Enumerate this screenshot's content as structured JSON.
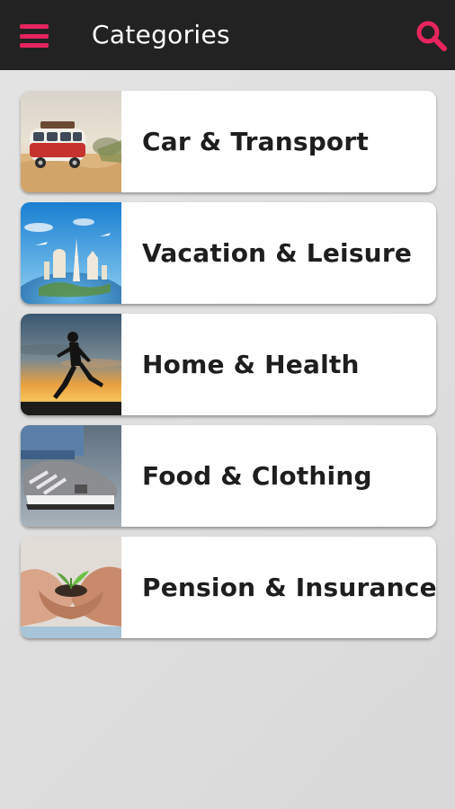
{
  "appbar": {
    "title": "Categories",
    "menu_icon": "hamburger-menu-icon",
    "search_icon": "search-icon",
    "accent_color": "#e8245f",
    "background_color": "#222222"
  },
  "categories": [
    {
      "label": "Car & Transport",
      "image": "vintage-van-on-beach"
    },
    {
      "label": "Vacation & Leisure",
      "image": "globe-with-world-landmarks"
    },
    {
      "label": "Home & Health",
      "image": "runner-silhouette-at-sunset"
    },
    {
      "label": "Food & Clothing",
      "image": "sneakers-close-up"
    },
    {
      "label": "Pension & Insurance",
      "image": "hands-holding-seedling"
    }
  ]
}
